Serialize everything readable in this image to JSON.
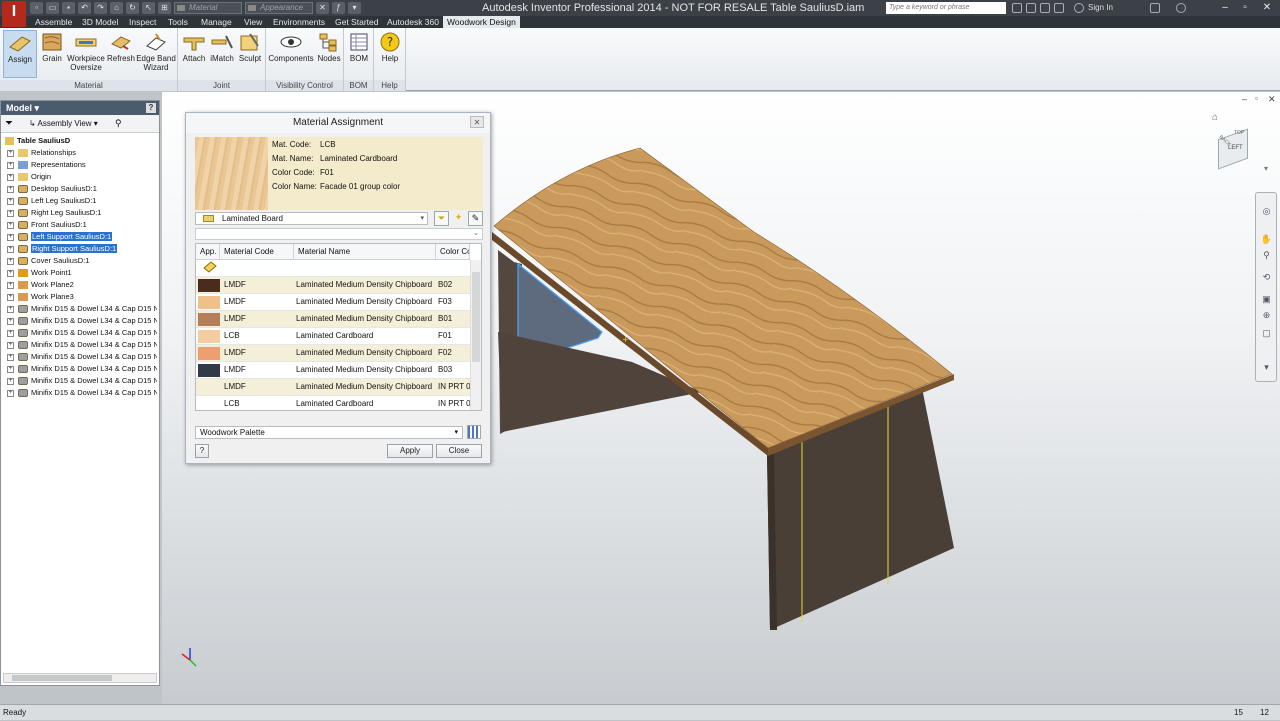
{
  "app": {
    "logo_letter": "I",
    "window_title": "Autodesk Inventor Professional 2014 - NOT FOR RESALE   Table SauliusD.iam",
    "search_placeholder": "Type a keyword or phrase",
    "sign_in": "Sign In",
    "material_combo": "Material",
    "appearance_combo": "Appearance"
  },
  "tabs": [
    "Assemble",
    "3D Model",
    "Inspect",
    "Tools",
    "Manage",
    "View",
    "Environments",
    "Get Started",
    "Autodesk 360",
    "Woodwork Design"
  ],
  "ribbon": {
    "groups": {
      "material": "Material",
      "joint": "Joint",
      "visibility": "Visibility Control",
      "bom": "BOM",
      "help": "Help"
    },
    "buttons": {
      "assign": "Assign",
      "grain": "Grain",
      "workpiece": "Workpiece Oversize",
      "refresh": "Refresh",
      "edgeband": "Edge Band Wizard",
      "attach": "Attach",
      "imatch": "iMatch",
      "sculpt": "Sculpt",
      "components": "Components",
      "nodes": "Nodes",
      "bom": "BOM",
      "help": "Help"
    }
  },
  "browser": {
    "title": "Model",
    "view": "Assembly View",
    "root": "Table SauliusD",
    "nodes": [
      {
        "label": "Relationships",
        "type": "folder"
      },
      {
        "label": "Representations",
        "type": "rep"
      },
      {
        "label": "Origin",
        "type": "folder"
      },
      {
        "label": "Desktop SauliusD:1",
        "type": "part"
      },
      {
        "label": "Left Leg SauliusD:1",
        "type": "part"
      },
      {
        "label": "Right Leg SauliusD:1",
        "type": "part"
      },
      {
        "label": "Front SauliusD:1",
        "type": "part"
      },
      {
        "label": "Left Support SauliusD:1",
        "type": "part",
        "selected": true
      },
      {
        "label": "Right Support SauliusD:1",
        "type": "part",
        "selected": true
      },
      {
        "label": "Cover SauliusD:1",
        "type": "part"
      },
      {
        "label": "Work Point1",
        "type": "point"
      },
      {
        "label": "Work Plane2",
        "type": "plane"
      },
      {
        "label": "Work Plane3",
        "type": "plane"
      },
      {
        "label": "Minifix D15 & Dowel L34 & Cap D15 NB T",
        "type": "fastener"
      },
      {
        "label": "Minifix D15 & Dowel L34 & Cap D15 NB T",
        "type": "fastener"
      },
      {
        "label": "Minifix D15 & Dowel L34 & Cap D15 NB T",
        "type": "fastener"
      },
      {
        "label": "Minifix D15 & Dowel L34 & Cap D15 NB T",
        "type": "fastener"
      },
      {
        "label": "Minifix D15 & Dowel L34 & Cap D15 NB T",
        "type": "fastener"
      },
      {
        "label": "Minifix D15 & Dowel L34 & Cap D15 NB T",
        "type": "fastener"
      },
      {
        "label": "Minifix D15 & Dowel L34 & Cap D15 NB T",
        "type": "fastener"
      },
      {
        "label": "Minifix D15 & Dowel L34 & Cap D15 NB T",
        "type": "fastener"
      }
    ]
  },
  "dialog": {
    "title": "Material Assignment",
    "info": {
      "code_label": "Mat. Code:",
      "code": "LCB",
      "name_label": "Mat. Name:",
      "name": "Laminated Cardboard",
      "color_code_label": "Color Code:",
      "color_code": "F01",
      "color_name_label": "Color Name:",
      "color_name": "Facade 01 group color"
    },
    "category": "Laminated Board",
    "columns": [
      "App.",
      "Material Code",
      "Material Name",
      "Color Co"
    ],
    "rows": [
      {
        "code": "LMDF",
        "name": "Laminated Medium Density Chipboard",
        "color": "B02",
        "swatch": "#4a2c1e"
      },
      {
        "code": "LMDF",
        "name": "Laminated Medium Density Chipboard",
        "color": "F03",
        "swatch": "#f0c08a"
      },
      {
        "code": "LMDF",
        "name": "Laminated Medium Density Chipboard",
        "color": "B01",
        "swatch": "#b47e5a"
      },
      {
        "code": "LCB",
        "name": "Laminated Cardboard",
        "color": "F01",
        "swatch": "#f3cc9f"
      },
      {
        "code": "LMDF",
        "name": "Laminated Medium Density Chipboard",
        "color": "F02",
        "swatch": "#ee9f72"
      },
      {
        "code": "LMDF",
        "name": "Laminated Medium Density Chipboard",
        "color": "B03",
        "swatch": "#323a48"
      },
      {
        "code": "LMDF",
        "name": "Laminated Medium Density Chipboard",
        "color": "IN PRT 01",
        "swatch": ""
      },
      {
        "code": "LCB",
        "name": "Laminated Cardboard",
        "color": "IN PRT 01",
        "swatch": ""
      }
    ],
    "palette": "Woodwork Palette",
    "apply": "Apply",
    "close": "Close"
  },
  "viewcube": {
    "face": "LEFT",
    "side": "BACK",
    "top": "TOP"
  },
  "status": {
    "text": "Ready",
    "count1": "15",
    "count2": "12"
  },
  "colors": {
    "accent": "#2a72d0",
    "wood": "#c89a5c",
    "leg": "#4b4038"
  }
}
